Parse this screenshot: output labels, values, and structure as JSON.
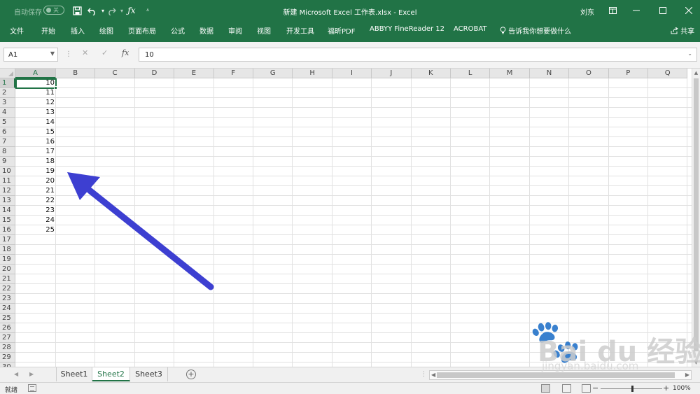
{
  "titlebar": {
    "autosave_label": "自动保存",
    "autosave_state": "关",
    "qat_icons": [
      "save-icon",
      "undo-icon",
      "dropdown-icon",
      "redo-icon",
      "fx-icon",
      "customize-qat-icon"
    ],
    "doc_title": "新建 Microsoft Excel 工作表.xlsx  -  Excel",
    "user": "刘东",
    "window_controls": [
      "ribbon-display-icon",
      "minimize-icon",
      "maximize-icon",
      "close-icon"
    ]
  },
  "ribbon": {
    "tabs": [
      "文件",
      "开始",
      "插入",
      "绘图",
      "页面布局",
      "公式",
      "数据",
      "审阅",
      "视图",
      "开发工具",
      "福昕PDF",
      "ABBYY FineReader 12",
      "ACROBAT"
    ],
    "tell_me": "告诉我你想要做什么",
    "share": "共享"
  },
  "formula_bar": {
    "name_box": "A1",
    "cancel_icon": "close-icon",
    "enter_icon": "check-icon",
    "fx_label": "fx",
    "value": "10"
  },
  "grid": {
    "columns": [
      "A",
      "B",
      "C",
      "D",
      "E",
      "F",
      "G",
      "H",
      "I",
      "J",
      "K",
      "L",
      "M",
      "N",
      "O",
      "P",
      "Q"
    ],
    "rows": [
      "1",
      "2",
      "3",
      "4",
      "5",
      "6",
      "7",
      "8",
      "9",
      "10",
      "11",
      "12",
      "13",
      "14",
      "15",
      "16",
      "17",
      "18",
      "19",
      "20",
      "21",
      "22",
      "23",
      "24",
      "25",
      "26",
      "27",
      "28",
      "29",
      "30"
    ],
    "selected_cell": "A1",
    "column_a_values": [
      "10",
      "11",
      "12",
      "13",
      "14",
      "15",
      "16",
      "17",
      "18",
      "19",
      "20",
      "21",
      "22",
      "23",
      "24",
      "25"
    ]
  },
  "sheets": {
    "tabs": [
      "Sheet1",
      "Sheet2",
      "Sheet3"
    ],
    "active": "Sheet2",
    "add_label": "+"
  },
  "statusbar": {
    "ready": "就绪",
    "zoom": "100%",
    "zoom_minus": "−",
    "zoom_plus": "+"
  },
  "annotation": {
    "arrow_color": "#3d3fd1"
  },
  "watermark": {
    "brand": "Bai du 经验",
    "site": "jingyan.baidu.com"
  },
  "colors": {
    "excel_green": "#217346",
    "header_bg": "#e6e6e6",
    "gridline": "#e1e1e1"
  }
}
